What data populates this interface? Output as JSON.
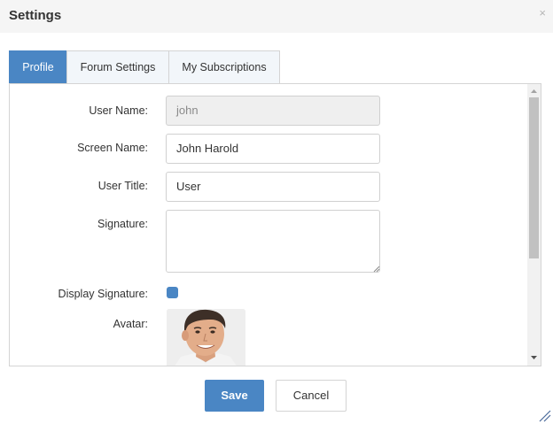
{
  "dialog": {
    "title": "Settings",
    "close_icon": "×"
  },
  "tabs": [
    {
      "label": "Profile",
      "active": true
    },
    {
      "label": "Forum Settings",
      "active": false
    },
    {
      "label": "My Subscriptions",
      "active": false
    }
  ],
  "profile": {
    "user_name_label": "User Name:",
    "user_name_value": "john",
    "screen_name_label": "Screen Name:",
    "screen_name_value": "John Harold",
    "user_title_label": "User Title:",
    "user_title_value": "User",
    "signature_label": "Signature:",
    "signature_value": "",
    "display_signature_label": "Display Signature:",
    "display_signature_checked": true,
    "avatar_label": "Avatar:"
  },
  "buttons": {
    "save_label": "Save",
    "cancel_label": "Cancel"
  },
  "colors": {
    "accent": "#4a86c4",
    "titlebar_bg": "#f5f5f5",
    "disabled_input_bg": "#efefef"
  }
}
